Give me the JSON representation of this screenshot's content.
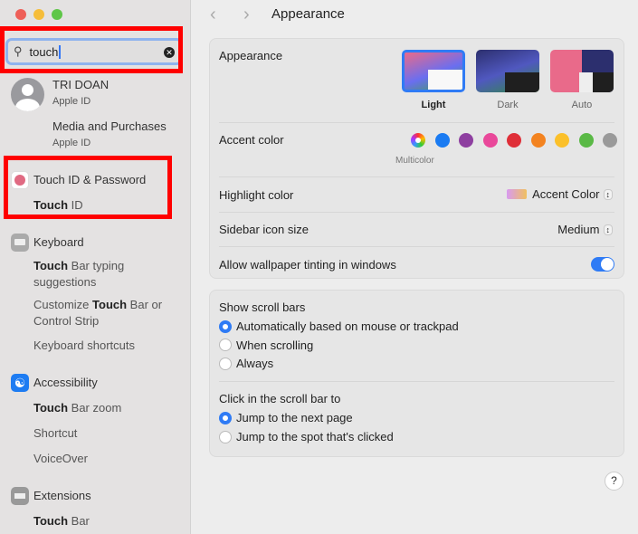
{
  "window": {
    "title": "Appearance"
  },
  "search": {
    "value": "touch",
    "placeholder": "Search"
  },
  "sidebar": {
    "account": {
      "name": "TRI DOAN",
      "sub": "Apple ID"
    },
    "media": {
      "label": "Media and Purchases",
      "sub": "Apple ID"
    },
    "sections": [
      {
        "label": "Touch ID & Password",
        "icon": "fingerprint-icon",
        "items": [
          {
            "bold": "Touch",
            "rest": " ID"
          }
        ]
      },
      {
        "label": "Keyboard",
        "icon": "keyboard-icon",
        "items": [
          {
            "bold": "Touch",
            "rest": " Bar typing suggestions"
          },
          {
            "pre": "Customize ",
            "bold": "Touch",
            "rest": " Bar or Control Strip"
          },
          {
            "rest": "Keyboard shortcuts"
          }
        ]
      },
      {
        "label": "Accessibility",
        "icon": "accessibility-icon",
        "items": [
          {
            "bold": "Touch",
            "rest": " Bar zoom"
          },
          {
            "rest": "Shortcut"
          },
          {
            "rest": "VoiceOver"
          }
        ]
      },
      {
        "label": "Extensions",
        "icon": "extensions-icon",
        "items": [
          {
            "bold": "Touch",
            "rest": " Bar"
          }
        ]
      }
    ]
  },
  "appearance": {
    "label": "Appearance",
    "options": [
      {
        "label": "Light",
        "selected": true
      },
      {
        "label": "Dark"
      },
      {
        "label": "Auto"
      }
    ],
    "accent_label": "Accent color",
    "accent_colors": [
      "multicolor",
      "#1a7bf2",
      "#8e3fa0",
      "#e9489a",
      "#df2f38",
      "#f38320",
      "#fbc02a",
      "#5ab946",
      "#9a9a9a"
    ],
    "accent_selected_name": "Multicolor",
    "highlight_label": "Highlight color",
    "highlight_value": "Accent Color",
    "icon_size_label": "Sidebar icon size",
    "icon_size_value": "Medium",
    "tinting_label": "Allow wallpaper tinting in windows",
    "tinting_on": true
  },
  "scroll": {
    "show_label": "Show scroll bars",
    "show_options": [
      "Automatically based on mouse or trackpad",
      "When scrolling",
      "Always"
    ],
    "show_selected": 0,
    "click_label": "Click in the scroll bar to",
    "click_options": [
      "Jump to the next page",
      "Jump to the spot that's clicked"
    ],
    "click_selected": 0
  },
  "help": "?"
}
